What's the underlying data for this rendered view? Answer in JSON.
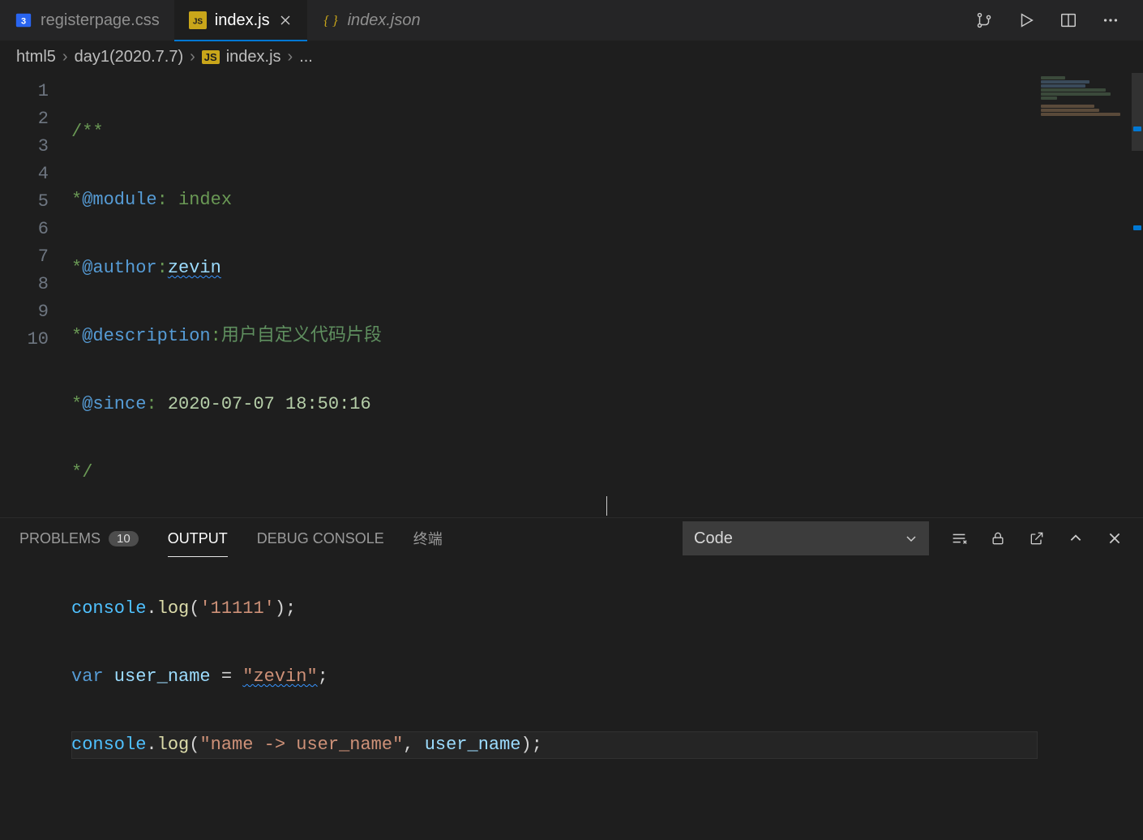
{
  "tabs": [
    {
      "label": "registerpage.css",
      "icon": "css",
      "active": false,
      "dim": false
    },
    {
      "label": "index.js",
      "icon": "js",
      "active": true,
      "dim": false
    },
    {
      "label": "index.json",
      "icon": "json",
      "active": false,
      "dim": true
    }
  ],
  "breadcrumb": {
    "seg1": "html5",
    "seg2": "day1(2020.7.7)",
    "seg3": "index.js",
    "seg4": "...",
    "js_badge": "JS"
  },
  "code": {
    "l1": "/**",
    "l2a": "*",
    "l2b": "@module",
    "l2c": ": index",
    "l3a": "*",
    "l3b": "@author",
    "l3c": ":",
    "l3d": "zevin",
    "l4a": "*",
    "l4b": "@description",
    "l4c": ":",
    "l4d": "用户自定义代码片段",
    "l5a": "*",
    "l5b": "@since",
    "l5c": ": ",
    "l5d": "2020-07-07 18:50:16",
    "l6": "*/",
    "l8a": "console",
    "l8b": ".",
    "l8c": "log",
    "l8d": "(",
    "l8e": "'11111'",
    "l8f": ");",
    "l9a": "var",
    "l9b": " user_name ",
    "l9c": "=",
    "l9d": " ",
    "l9e": "\"zevin\"",
    "l9f": ";",
    "l10a": "console",
    "l10b": ".",
    "l10c": "log",
    "l10d": "(",
    "l10e": "\"name -> user_name\"",
    "l10f": ", ",
    "l10g": "user_name",
    "l10h": ");"
  },
  "line_numbers": [
    "1",
    "2",
    "3",
    "4",
    "5",
    "6",
    "7",
    "8",
    "9",
    "10"
  ],
  "panel": {
    "tabs": {
      "problems": "PROBLEMS",
      "problems_count": "10",
      "output": "OUTPUT",
      "debug": "DEBUG CONSOLE",
      "terminal": "终端"
    },
    "select_value": "Code"
  }
}
